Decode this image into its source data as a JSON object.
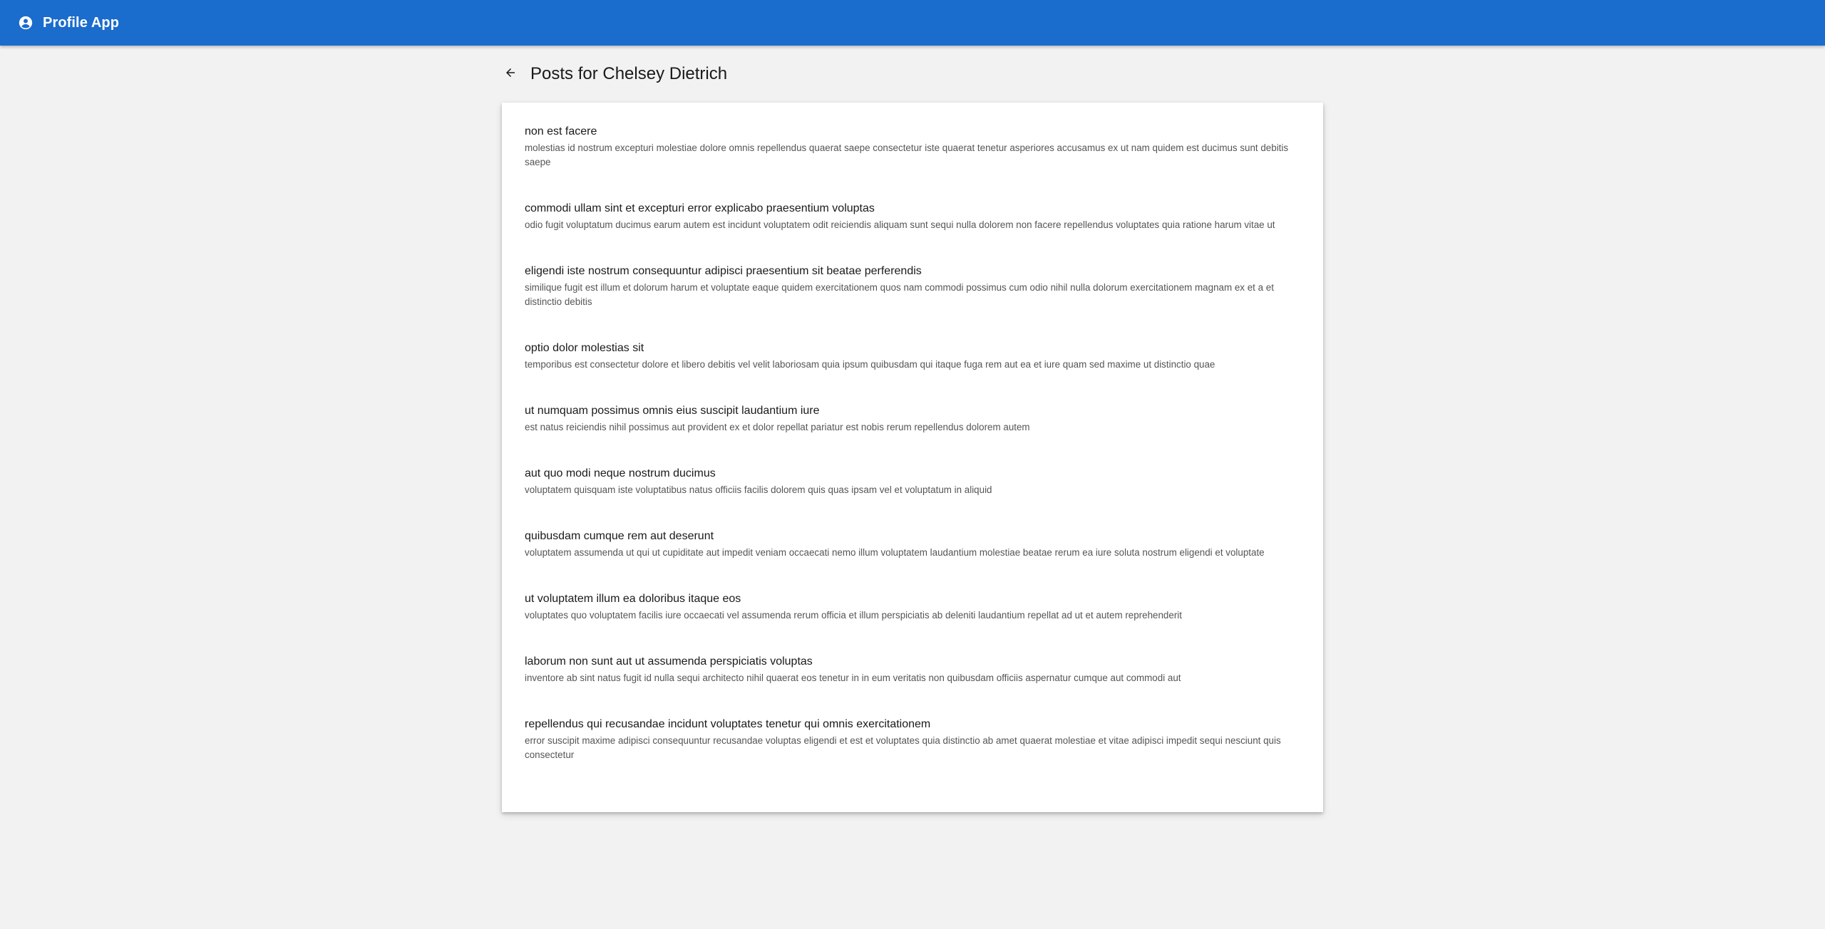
{
  "app": {
    "title": "Profile App",
    "brand_color": "#1a6ccd",
    "icon": "account-circle-icon"
  },
  "page": {
    "title": "Posts for Chelsey Dietrich",
    "back_icon": "arrow-back-icon"
  },
  "posts": [
    {
      "title": "non est facere",
      "body": "molestias id nostrum excepturi molestiae dolore omnis repellendus quaerat saepe consectetur iste quaerat tenetur asperiores accusamus ex ut nam quidem est ducimus sunt debitis saepe"
    },
    {
      "title": "commodi ullam sint et excepturi error explicabo praesentium voluptas",
      "body": "odio fugit voluptatum ducimus earum autem est incidunt voluptatem odit reiciendis aliquam sunt sequi nulla dolorem non facere repellendus voluptates quia ratione harum vitae ut"
    },
    {
      "title": "eligendi iste nostrum consequuntur adipisci praesentium sit beatae perferendis",
      "body": "similique fugit est illum et dolorum harum et voluptate eaque quidem exercitationem quos nam commodi possimus cum odio nihil nulla dolorum exercitationem magnam ex et a et distinctio debitis"
    },
    {
      "title": "optio dolor molestias sit",
      "body": "temporibus est consectetur dolore et libero debitis vel velit laboriosam quia ipsum quibusdam qui itaque fuga rem aut ea et iure quam sed maxime ut distinctio quae"
    },
    {
      "title": "ut numquam possimus omnis eius suscipit laudantium iure",
      "body": "est natus reiciendis nihil possimus aut provident ex et dolor repellat pariatur est nobis rerum repellendus dolorem autem"
    },
    {
      "title": "aut quo modi neque nostrum ducimus",
      "body": "voluptatem quisquam iste voluptatibus natus officiis facilis dolorem quis quas ipsam vel et voluptatum in aliquid"
    },
    {
      "title": "quibusdam cumque rem aut deserunt",
      "body": "voluptatem assumenda ut qui ut cupiditate aut impedit veniam occaecati nemo illum voluptatem laudantium molestiae beatae rerum ea iure soluta nostrum eligendi et voluptate"
    },
    {
      "title": "ut voluptatem illum ea doloribus itaque eos",
      "body": "voluptates quo voluptatem facilis iure occaecati vel assumenda rerum officia et illum perspiciatis ab deleniti laudantium repellat ad ut et autem reprehenderit"
    },
    {
      "title": "laborum non sunt aut ut assumenda perspiciatis voluptas",
      "body": "inventore ab sint natus fugit id nulla sequi architecto nihil quaerat eos tenetur in in eum veritatis non quibusdam officiis aspernatur cumque aut commodi aut"
    },
    {
      "title": "repellendus qui recusandae incidunt voluptates tenetur qui omnis exercitationem",
      "body": "error suscipit maxime adipisci consequuntur recusandae voluptas eligendi et est et voluptates quia distinctio ab amet quaerat molestiae et vitae adipisci impedit sequi nesciunt quis consectetur"
    }
  ]
}
